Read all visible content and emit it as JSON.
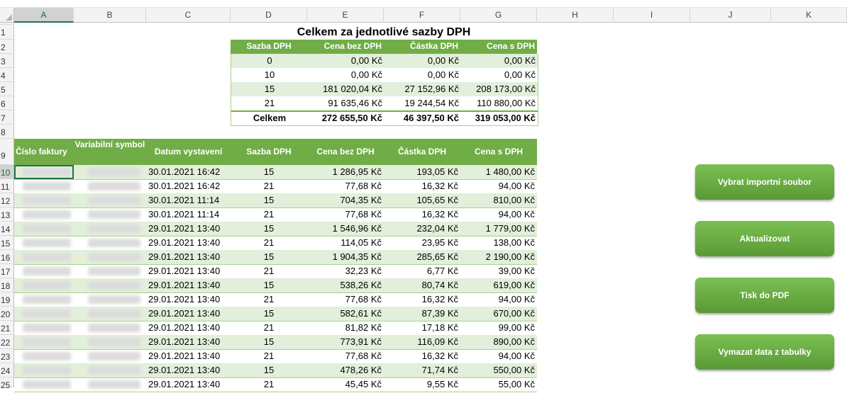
{
  "columns": [
    "A",
    "B",
    "C",
    "D",
    "E",
    "F",
    "G",
    "H",
    "I",
    "J",
    "K"
  ],
  "selected_column": "A",
  "row_numbers": [
    "1",
    "2",
    "3",
    "4",
    "5",
    "6",
    "7",
    "8",
    "9",
    "10",
    "11",
    "12",
    "13",
    "14",
    "15",
    "16",
    "17",
    "18",
    "19",
    "20",
    "21",
    "22",
    "23",
    "24",
    "25"
  ],
  "selected_row": "10",
  "summary": {
    "title": "Celkem za jednotlivé sazby DPH",
    "headers": [
      "Sazba DPH",
      "Cena bez DPH",
      "Částka DPH",
      "Cena s DPH"
    ],
    "rows": [
      [
        "0",
        "0,00 Kč",
        "0,00 Kč",
        "0,00 Kč"
      ],
      [
        "10",
        "0,00 Kč",
        "0,00 Kč",
        "0,00 Kč"
      ],
      [
        "15",
        "181 020,04 Kč",
        "27 152,96 Kč",
        "208 173,00 Kč"
      ],
      [
        "21",
        "91 635,46 Kč",
        "19 244,54 Kč",
        "110 880,00 Kč"
      ]
    ],
    "total": [
      "Celkem",
      "272 655,50 Kč",
      "46 397,50 Kč",
      "319 053,00 Kč"
    ]
  },
  "table": {
    "headers": [
      "Číslo faktury",
      "Variabilní symbol",
      "Datum vystavení",
      "Sazba DPH",
      "Cena bez DPH",
      "Částka DPH",
      "Cena s DPH"
    ],
    "rows": [
      [
        "30.01.2021 16:42",
        "15",
        "1 286,95 Kč",
        "193,05 Kč",
        "1 480,00 Kč"
      ],
      [
        "30.01.2021 16:42",
        "21",
        "77,68 Kč",
        "16,32 Kč",
        "94,00 Kč"
      ],
      [
        "30.01.2021 11:14",
        "15",
        "704,35 Kč",
        "105,65 Kč",
        "810,00 Kč"
      ],
      [
        "30.01.2021 11:14",
        "21",
        "77,68 Kč",
        "16,32 Kč",
        "94,00 Kč"
      ],
      [
        "29.01.2021 13:40",
        "15",
        "1 546,96 Kč",
        "232,04 Kč",
        "1 779,00 Kč"
      ],
      [
        "29.01.2021 13:40",
        "21",
        "114,05 Kč",
        "23,95 Kč",
        "138,00 Kč"
      ],
      [
        "29.01.2021 13:40",
        "15",
        "1 904,35 Kč",
        "285,65 Kč",
        "2 190,00 Kč"
      ],
      [
        "29.01.2021 13:40",
        "21",
        "32,23 Kč",
        "6,77 Kč",
        "39,00 Kč"
      ],
      [
        "29.01.2021 13:40",
        "15",
        "538,26 Kč",
        "80,74 Kč",
        "619,00 Kč"
      ],
      [
        "29.01.2021 13:40",
        "21",
        "77,68 Kč",
        "16,32 Kč",
        "94,00 Kč"
      ],
      [
        "29.01.2021 13:40",
        "15",
        "582,61 Kč",
        "87,39 Kč",
        "670,00 Kč"
      ],
      [
        "29.01.2021 13:40",
        "21",
        "81,82 Kč",
        "17,18 Kč",
        "99,00 Kč"
      ],
      [
        "29.01.2021 13:40",
        "15",
        "773,91 Kč",
        "116,09 Kč",
        "890,00 Kč"
      ],
      [
        "29.01.2021 13:40",
        "21",
        "77,68 Kč",
        "16,32 Kč",
        "94,00 Kč"
      ],
      [
        "29.01.2021 13:40",
        "15",
        "478,26 Kč",
        "71,74 Kč",
        "550,00 Kč"
      ],
      [
        "29.01.2021 13:40",
        "21",
        "45,45 Kč",
        "9,55 Kč",
        "55,00 Kč"
      ]
    ]
  },
  "buttons": [
    "Vybrat importní soubor",
    "Aktualizovat",
    "Tisk do PDF",
    "Vymazat data z tabulky"
  ],
  "colors": {
    "header_green": "#70ad47",
    "band_green": "#e2efda",
    "button_green": "#6aab44",
    "excel_green": "#217346"
  }
}
